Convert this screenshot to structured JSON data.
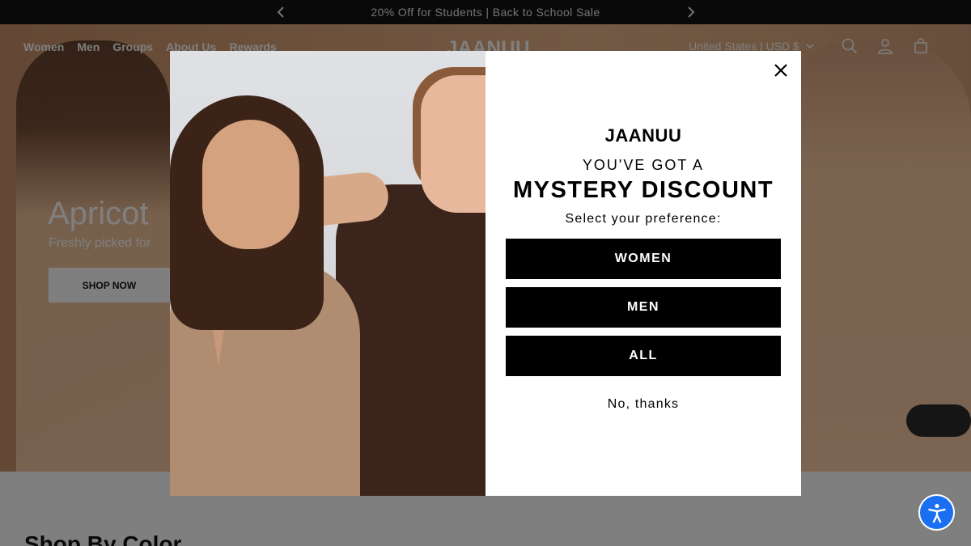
{
  "announcement": {
    "text": "20% Off for Students | Back to School Sale",
    "prev_icon": "chevron-left-icon",
    "next_icon": "chevron-right-icon"
  },
  "nav": {
    "links": [
      "Women",
      "Men",
      "Groups",
      "About Us",
      "Rewards"
    ],
    "logo": "JAANUU",
    "region": "United States | USD $",
    "icons": [
      "search-icon",
      "account-icon",
      "cart-icon"
    ]
  },
  "hero": {
    "title": "Apricot",
    "subtitle": "Freshly picked for",
    "cta": "SHOP NOW"
  },
  "section": {
    "title": "Shop By Color"
  },
  "popup": {
    "brand": "JAANUU",
    "heading_line1": "YOU'VE GOT A",
    "heading_line2": "MYSTERY DISCOUNT",
    "prompt": "Select your preference:",
    "options": [
      "WOMEN",
      "MEN",
      "ALL"
    ],
    "dismiss": "No, thanks",
    "close_icon": "close-icon"
  },
  "colors": {
    "announcement_bg": "#121212",
    "button_bg": "#000000",
    "accessibility_blue": "#1a6ff0"
  }
}
